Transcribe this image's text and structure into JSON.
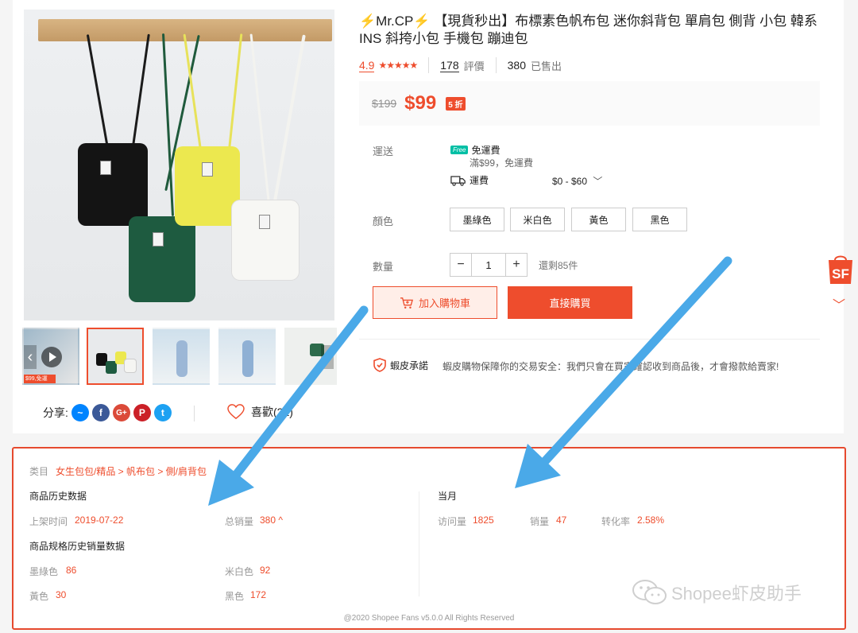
{
  "product": {
    "title": "⚡️Mr.CP⚡️ 【現貨秒出】布標素色帆布包 迷你斜背包 單肩包 側背 小包 韓系 INS 斜挎小包 手機包 蹦迪包",
    "rating": "4.9",
    "reviews_count": "178",
    "reviews_label": "評價",
    "sold_count": "380",
    "sold_label": "已售出",
    "old_price": "$199",
    "price": "$99",
    "discount": "5 折",
    "stars": "★★★★★"
  },
  "shipping": {
    "label": "運送",
    "free_badge": "Free",
    "free_text": "免運費",
    "free_sub": "滿$99，免運費",
    "fee_label": "運費",
    "fee_range": "$0 - $60"
  },
  "colors": {
    "label": "顏色",
    "options": [
      "墨綠色",
      "米白色",
      "黃色",
      "黑色"
    ]
  },
  "quantity": {
    "label": "數量",
    "minus": "−",
    "value": "1",
    "plus": "+",
    "stock": "還剩85件"
  },
  "actions": {
    "add_to_cart": "加入購物車",
    "buy_now": "直接購買"
  },
  "guarantee": {
    "title": "蝦皮承諾",
    "text": "蝦皮購物保障你的交易安全：我們只會在買家確認收到商品後，才會撥款給賣家!"
  },
  "gallery": {
    "promo": "$99,免運"
  },
  "share": {
    "label": "分享:",
    "networks": [
      "messenger",
      "facebook",
      "google-plus",
      "pinterest",
      "twitter"
    ]
  },
  "like": {
    "label": "喜歡(22)"
  },
  "floating": {
    "sf_label": "SF"
  },
  "plugin": {
    "category_label": "类目",
    "category_path": "女生包包/精品 > 帆布包 > 側/肩背包",
    "history_title": "商品历史数据",
    "listed_label": "上架时间",
    "listed_value": "2019-07-22",
    "total_sales_label": "总销量",
    "total_sales_value": "380 ^",
    "variants_title": "商品规格历史销量数据",
    "variants": [
      {
        "name": "墨綠色",
        "value": "86"
      },
      {
        "name": "米白色",
        "value": "92"
      },
      {
        "name": "黃色",
        "value": "30"
      },
      {
        "name": "黑色",
        "value": "172"
      }
    ],
    "month_title": "当月",
    "visits_label": "访问量",
    "visits_value": "1825",
    "sales_label": "销量",
    "sales_value": "47",
    "conversion_label": "转化率",
    "conversion_value": "2.58%",
    "footer": "@2020 Shopee Fans v5.0.0 All Rights Reserved"
  },
  "watermark": {
    "text": "Shopee虾皮助手"
  },
  "colors_theme": {
    "accent": "#ee4d2d",
    "arrow": "#4aa9e8"
  }
}
